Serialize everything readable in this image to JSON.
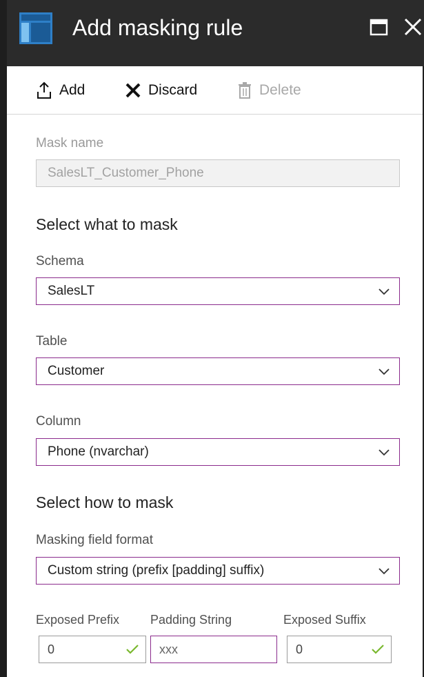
{
  "window": {
    "title": "Add masking rule"
  },
  "toolbar": {
    "add_label": "Add",
    "discard_label": "Discard",
    "delete_label": "Delete"
  },
  "form": {
    "mask_name": {
      "label": "Mask name",
      "value": "SalesLT_Customer_Phone"
    },
    "what_section": "Select what to mask",
    "schema": {
      "label": "Schema",
      "value": "SalesLT"
    },
    "table": {
      "label": "Table",
      "value": "Customer"
    },
    "column": {
      "label": "Column",
      "value": "Phone (nvarchar)"
    },
    "how_section": "Select how to mask",
    "format": {
      "label": "Masking field format",
      "value": "Custom string (prefix [padding] suffix)"
    },
    "exposed_prefix": {
      "label": "Exposed Prefix",
      "value": "0"
    },
    "padding_string": {
      "label": "Padding String",
      "value": "xxx"
    },
    "exposed_suffix": {
      "label": "Exposed Suffix",
      "value": "0"
    }
  },
  "colors": {
    "titlebar": "#2b2b2b",
    "accent_border": "#8a2a8c",
    "valid_check": "#7ab82e",
    "icon_blue": "#2e7fc7"
  }
}
